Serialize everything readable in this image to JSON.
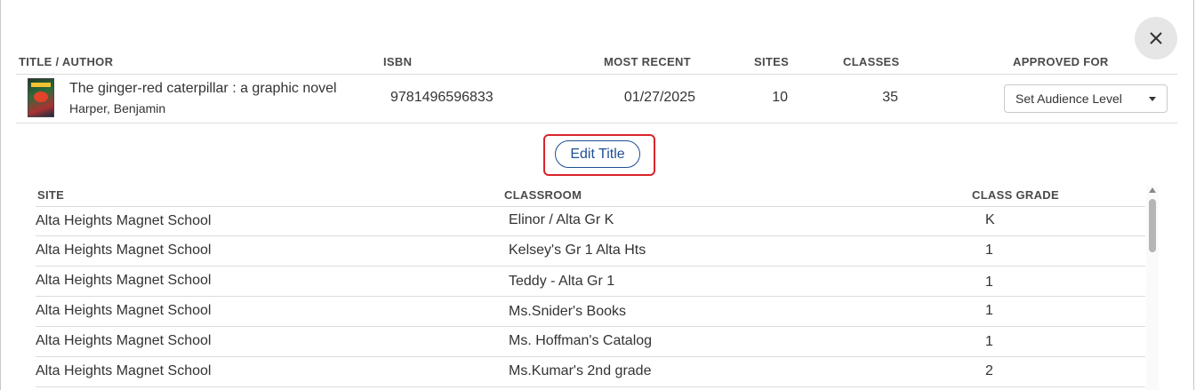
{
  "dialog": {
    "close_icon": "close-icon"
  },
  "title_table": {
    "headers": {
      "title_author": "TITLE / AUTHOR",
      "isbn": "ISBN",
      "most_recent": "MOST RECENT",
      "sites": "SITES",
      "classes": "CLASSES",
      "approved_for": "APPROVED FOR"
    },
    "row": {
      "title": "The ginger-red caterpillar : a graphic novel",
      "author": "Harper, Benjamin",
      "isbn": "9781496596833",
      "most_recent": "01/27/2025",
      "sites": "10",
      "classes": "35",
      "approved_for_select": "Set Audience Level"
    }
  },
  "edit_title_button": "Edit Title",
  "class_table": {
    "headers": {
      "site": "SITE",
      "classroom": "CLASSROOM",
      "class_grade": "CLASS GRADE"
    },
    "rows": [
      {
        "site": "Alta Heights Magnet School",
        "classroom": "Elinor / Alta Gr K",
        "grade": "K"
      },
      {
        "site": "Alta Heights Magnet School",
        "classroom": "Kelsey's Gr 1 Alta Hts",
        "grade": "1"
      },
      {
        "site": "Alta Heights Magnet School",
        "classroom": "Teddy - Alta Gr 1",
        "grade": "1"
      },
      {
        "site": "Alta Heights Magnet School",
        "classroom": "Ms.Snider's Books",
        "grade": "1"
      },
      {
        "site": "Alta Heights Magnet School",
        "classroom": "Ms. Hoffman's Catalog",
        "grade": "1"
      },
      {
        "site": "Alta Heights Magnet School",
        "classroom": "Ms.Kumar's 2nd grade",
        "grade": "2"
      }
    ]
  },
  "colors": {
    "accent_blue": "#1f4e96",
    "highlight_red": "#d9242c"
  }
}
